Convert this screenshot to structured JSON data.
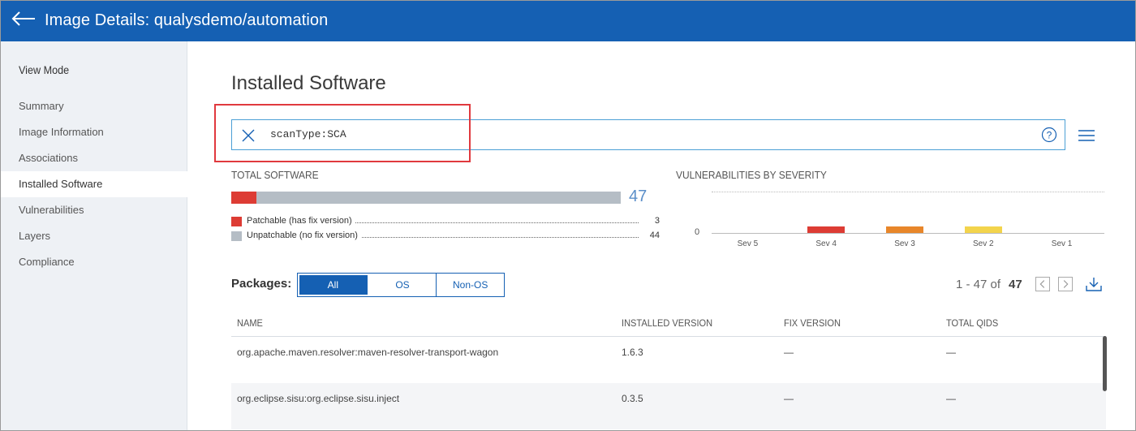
{
  "header": {
    "title": "Image Details: qualysdemo/automation"
  },
  "sidebar": {
    "heading": "View Mode",
    "items": [
      {
        "label": "Summary"
      },
      {
        "label": "Image Information"
      },
      {
        "label": "Associations"
      },
      {
        "label": "Installed Software",
        "active": true
      },
      {
        "label": "Vulnerabilities"
      },
      {
        "label": "Layers"
      },
      {
        "label": "Compliance"
      }
    ]
  },
  "main": {
    "title": "Installed Software",
    "search": {
      "value": "scanType:SCA"
    },
    "total_software": {
      "label": "TOTAL SOFTWARE",
      "total": "47",
      "patchable_fraction": 0.064,
      "legend": [
        {
          "label": "Patchable (has fix version)",
          "value": "3",
          "color": "#dd3c34"
        },
        {
          "label": "Unpatchable (no fix version)",
          "value": "44",
          "color": "#b5bdc5"
        }
      ]
    },
    "severity": {
      "label": "VULNERABILITIES BY SEVERITY",
      "zero_tick": "0"
    },
    "packages": {
      "label": "Packages:",
      "filters": [
        {
          "label": "All",
          "active": true
        },
        {
          "label": "OS"
        },
        {
          "label": "Non-OS"
        }
      ]
    },
    "pager": {
      "range": "1 - 47 of",
      "total": "47"
    },
    "table": {
      "columns": [
        "NAME",
        "INSTALLED VERSION",
        "FIX VERSION",
        "TOTAL QIDS"
      ],
      "rows": [
        {
          "name": "org.apache.maven.resolver:maven-resolver-transport-wagon",
          "installed": "1.6.3",
          "fix": "—",
          "qids": "—"
        },
        {
          "name": "org.eclipse.sisu:org.eclipse.sisu.inject",
          "installed": "0.3.5",
          "fix": "—",
          "qids": "—"
        }
      ]
    }
  },
  "chart_data": {
    "type": "bar",
    "title": "VULNERABILITIES BY SEVERITY",
    "categories": [
      "Sev 5",
      "Sev 4",
      "Sev 3",
      "Sev 2",
      "Sev 1"
    ],
    "values": [
      0,
      1,
      1,
      1,
      0
    ],
    "colors": [
      "#8b1a1a",
      "#dd3c34",
      "#e8862a",
      "#f3d44c",
      "#7aa8d8"
    ],
    "ylim": [
      0,
      10
    ],
    "grid": false
  }
}
